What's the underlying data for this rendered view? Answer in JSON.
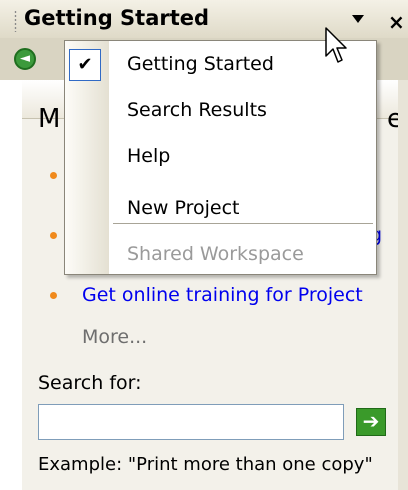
{
  "task_pane": {
    "title": "Getting Started",
    "section_header_left": "M",
    "section_header_right": "e",
    "link_partial_tail": "g",
    "link_training": "Get online training for Project",
    "more": "More...",
    "search_label": "Search for:",
    "search_value": "",
    "example": "Example:  \"Print more than one copy\""
  },
  "menu": {
    "items": [
      {
        "label": "Getting Started",
        "checked": true,
        "disabled": false
      },
      {
        "label": "Search Results",
        "checked": false,
        "disabled": false
      },
      {
        "label": "Help",
        "checked": false,
        "disabled": false
      },
      {
        "label": "New Project",
        "checked": false,
        "disabled": false
      },
      {
        "label": "Shared Workspace",
        "checked": false,
        "disabled": true
      }
    ]
  },
  "icons": {
    "back": "back-arrow-icon",
    "close": "close-icon",
    "dropdown": "dropdown-arrow-icon",
    "go": "go-arrow-icon",
    "check": "check-icon"
  },
  "colors": {
    "link": "#0000ee",
    "bullet": "#f08a1c",
    "go_button": "#3a9a2a",
    "highlight_border": "#316ac5"
  }
}
